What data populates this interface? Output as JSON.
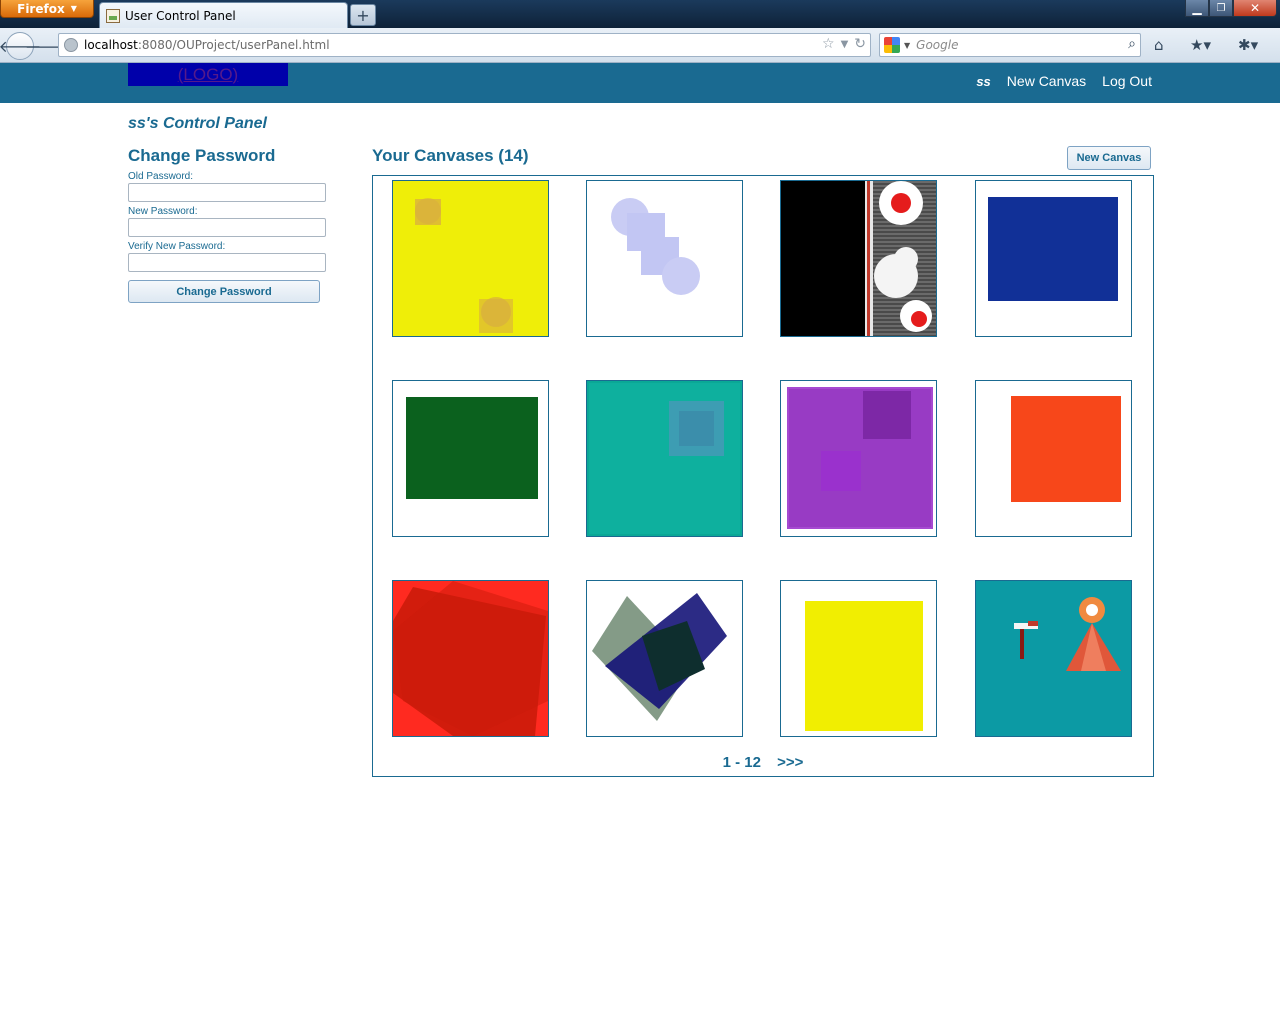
{
  "browser": {
    "app_menu": "Firefox",
    "tab_title": "User Control Panel",
    "new_tab": "+",
    "url_host": "localhost",
    "url_rest": ":8080/OUProject/userPanel.html",
    "search_placeholder": "Google"
  },
  "header": {
    "logo": "(LOGO)",
    "user": "ss",
    "new_canvas": "New Canvas",
    "log_out": "Log Out"
  },
  "panel_title": "ss's Control Panel",
  "change_password": {
    "heading": "Change Password",
    "old_label": "Old Password:",
    "new_label": "New Password:",
    "verify_label": "Verify New Password:",
    "button": "Change Password"
  },
  "canvases": {
    "heading": "Your Canvases (14)",
    "new_button": "New Canvas",
    "thumbnails": [
      "yellow",
      "light-blue-shapes",
      "black-white-splatter",
      "blue",
      "green",
      "teal",
      "purple",
      "orange",
      "red",
      "navy-grey-diamond",
      "yellow-square",
      "teal-cone"
    ],
    "pager_range": "1 - 12",
    "pager_next": ">>>"
  }
}
